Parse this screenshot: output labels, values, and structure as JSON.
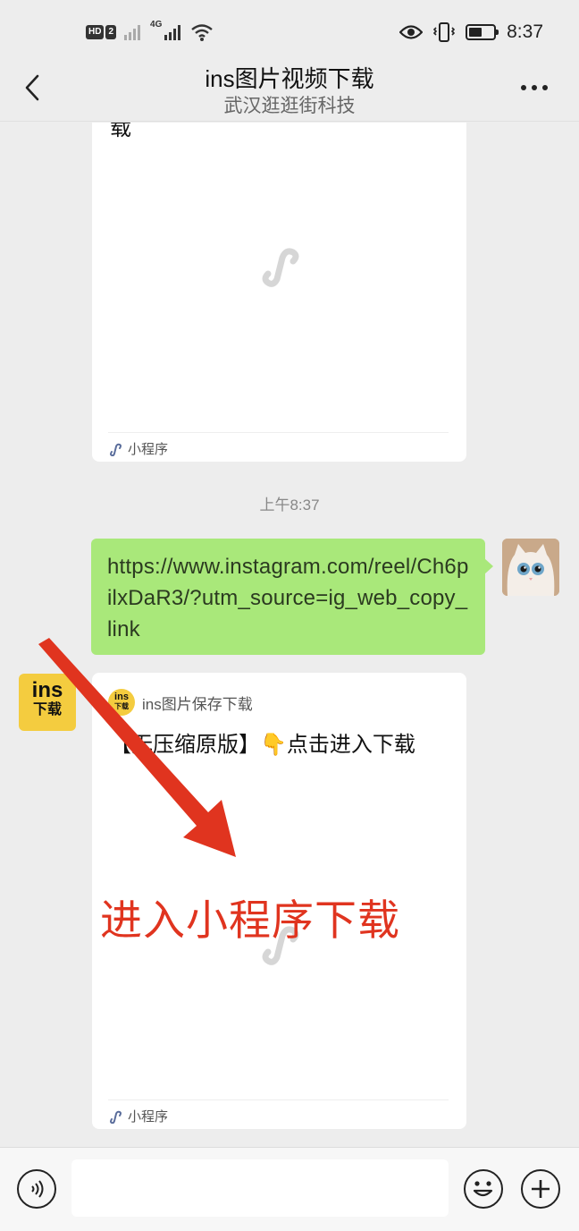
{
  "status_bar": {
    "hd_label": "HD",
    "sim_label": "2",
    "network_label": "4G",
    "time": "8:37",
    "battery_level": 0.55
  },
  "header": {
    "title": "ins图片视频下载",
    "subtitle": "武汉逛逛街科技"
  },
  "messages": {
    "top_card": {
      "cut_text": "载",
      "footer_label": "小程序"
    },
    "timestamp": "上午8:37",
    "sent_link": "https://www.instagram.com/reel/Ch6pilxDaR3/?utm_source=ig_web_copy_link",
    "bot_avatar": {
      "line1": "ins",
      "line2": "下载"
    },
    "mini_program_card": {
      "source_icon_line1": "ins",
      "source_icon_line2": "下载",
      "source_name": "ins图片保存下载",
      "description": "【无压缩原版】👇点击进入下载",
      "footer_label": "小程序"
    }
  },
  "annotation": {
    "text": "进入小程序下载",
    "color": "#e0341f"
  },
  "colors": {
    "background": "#ededed",
    "sent_bubble": "#a9e87a",
    "bot_avatar": "#f4cc3f"
  },
  "icons": [
    "back-arrow-icon",
    "more-icon",
    "voice-icon",
    "emoji-icon",
    "plus-icon",
    "mini-program-icon",
    "eye-icon",
    "vibrate-icon",
    "wifi-icon",
    "signal-icon",
    "battery-icon"
  ]
}
